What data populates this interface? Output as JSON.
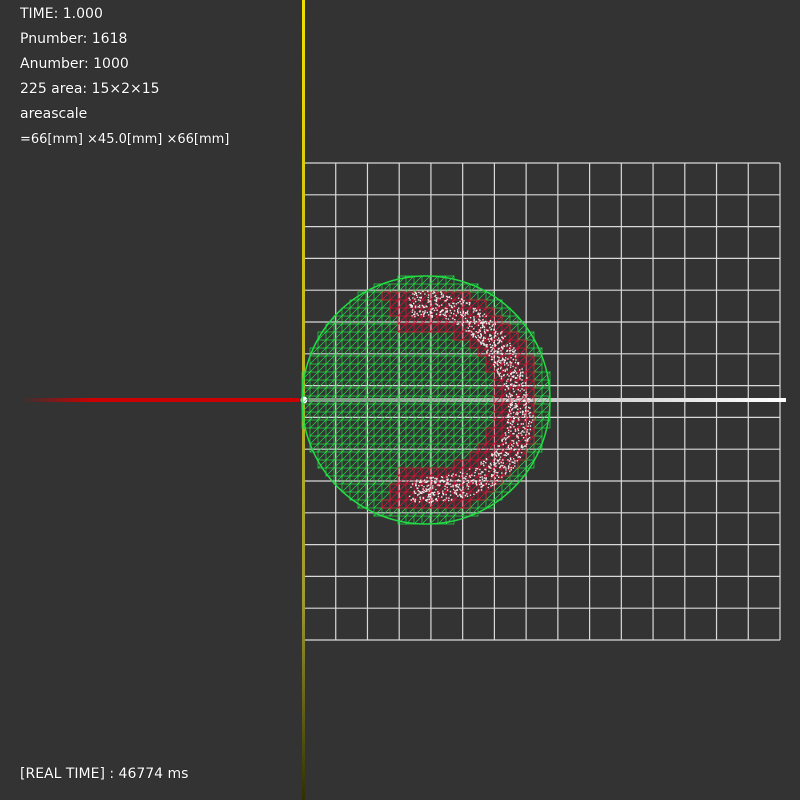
{
  "hud": {
    "time": "TIME: 1.000",
    "pnumber": "Pnumber: 1618",
    "anumber": "Anumber: 1000",
    "area": "225 area: 15×2×15",
    "areascale_label": "areascale",
    "areascale_value": "=66[mm] ×45.0[mm] ×66[mm]",
    "real_time": "[REAL TIME] : 46774 ms"
  },
  "colors": {
    "background": "#333333",
    "grid": "#d9d9d9",
    "y_axis": "#e8d800",
    "x_axis_negative": "#cc0000",
    "x_axis_positive": "#ffffff",
    "mesh_green": "#22dd44",
    "mesh_red": "#dd1133",
    "particles": "#ffffff"
  },
  "scene": {
    "grid_cells": [
      15,
      15
    ]
  }
}
